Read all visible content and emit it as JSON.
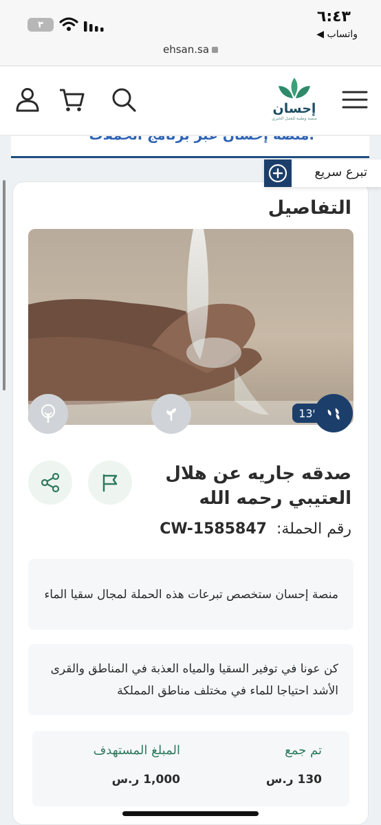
{
  "status_bar": {
    "time": "٦:٤٣",
    "back_app": "◀ واتساب",
    "battery_level": "٣",
    "url": "ehsan.sa"
  },
  "header": {
    "logo_name": "إحسان",
    "logo_tagline": "منصة وطنية للعمل الخيري",
    "icons": [
      "menu-icon",
      "user-icon",
      "cart-icon",
      "search-icon"
    ]
  },
  "banner": {
    "text": "منصة إحسان عبر برنامج الحملات."
  },
  "quick_donate": {
    "label": "تبرع سريع"
  },
  "card": {
    "heading": "التفاصيل",
    "progress_percent_label": "13%",
    "progress_percent": 13,
    "title": "صدقه جاريه عن هلال العتيبي رحمه الله",
    "campaign_label": "رقم الحملة:",
    "campaign_number": "CW-1585847",
    "note_1": "منصة إحسان ستخصص تبرعات هذه الحملة لمجال سقيا الماء",
    "note_2": "كن عونا في توفير السقيا والمياه العذبة في المناطق والقرى الأشد احتياجا للماء في مختلف مناطق المملكة",
    "collected_label": "تم جمع",
    "collected_value": "130 ر.س",
    "target_label": "المبلغ المستهدف",
    "target_value": "1,000 ر.س"
  },
  "colors": {
    "navy": "#1c3e6b",
    "green": "#2d7a5e",
    "banner_text": "#2f63b5"
  }
}
